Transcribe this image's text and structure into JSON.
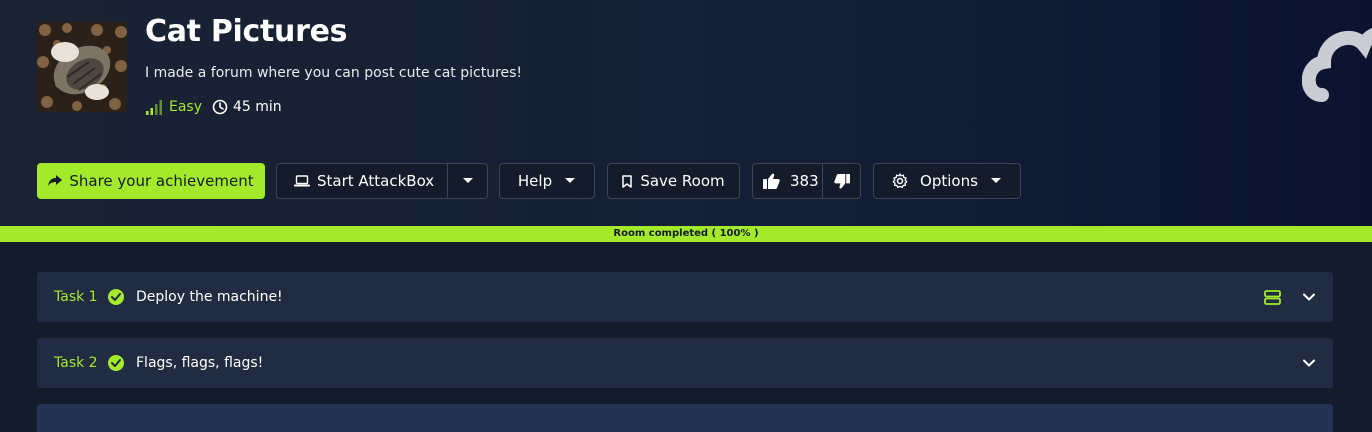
{
  "room": {
    "title": "Cat Pictures",
    "description": "I made a forum where you can post cute cat pictures!",
    "difficulty": "Easy",
    "duration": "45 min"
  },
  "actions": {
    "share_label": "Share your achievement",
    "attackbox_label": "Start AttackBox",
    "help_label": "Help",
    "save_label": "Save Room",
    "upvotes": "383",
    "options_label": "Options"
  },
  "progress": {
    "label": "Room completed ( 100% )",
    "percent": 100
  },
  "tasks": [
    {
      "number": "Task 1",
      "name": "Deploy the machine!",
      "completed": true
    },
    {
      "number": "Task 2",
      "name": "Flags, flags, flags!",
      "completed": true
    }
  ],
  "colors": {
    "accent": "#a3ea2a",
    "background": "#141c2b",
    "task_bg": "#212c42"
  },
  "icons": [
    "share-icon",
    "laptop-icon",
    "chevron-down-icon",
    "bookmark-icon",
    "thumbs-up-icon",
    "thumbs-down-icon",
    "gear-icon",
    "check-icon",
    "server-icon",
    "clock-icon",
    "signal-icon",
    "cloud-icon"
  ]
}
